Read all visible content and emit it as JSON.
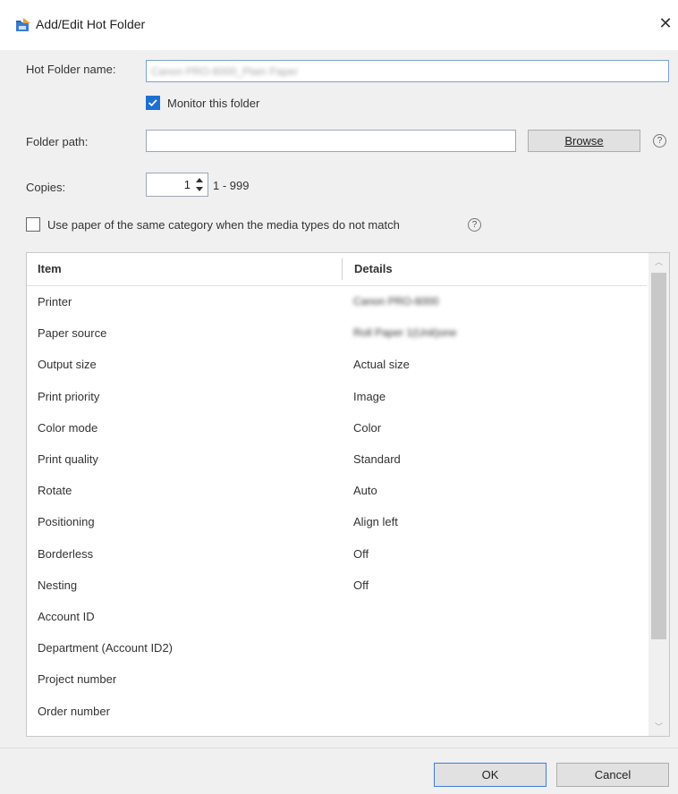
{
  "window": {
    "title": "Add/Edit Hot Folder",
    "close_glyph": "✕"
  },
  "form": {
    "hot_folder_name_label": "Hot Folder name:",
    "hot_folder_name_value": "Canon PRO-6000_Plain Paper",
    "monitor_label": "Monitor this folder",
    "monitor_checked": true,
    "folder_path_label": "Folder path:",
    "folder_path_value": "",
    "browse_label": "Browse",
    "copies_label": "Copies:",
    "copies_value": "1",
    "copies_range": "1 - 999",
    "same_category_label": "Use paper of the same category when the media types do not match",
    "same_category_checked": false,
    "help_glyph": "?"
  },
  "table": {
    "columns": [
      "Item",
      "Details"
    ],
    "rows": [
      {
        "item": "Printer",
        "details": "Canon PRO-6000",
        "blurred": true
      },
      {
        "item": "Paper source",
        "details": "Roll Paper 1(Unit)one",
        "blurred": true
      },
      {
        "item": "Output size",
        "details": "Actual size",
        "blurred": false
      },
      {
        "item": "Print priority",
        "details": "Image",
        "blurred": false
      },
      {
        "item": "Color mode",
        "details": "Color",
        "blurred": false
      },
      {
        "item": "Print quality",
        "details": "Standard",
        "blurred": false
      },
      {
        "item": "Rotate",
        "details": "Auto",
        "blurred": false
      },
      {
        "item": "Positioning",
        "details": "Align left",
        "blurred": false
      },
      {
        "item": "Borderless",
        "details": "Off",
        "blurred": false
      },
      {
        "item": "Nesting",
        "details": "Off",
        "blurred": false
      },
      {
        "item": "Account ID",
        "details": "",
        "blurred": false
      },
      {
        "item": "Department (Account ID2)",
        "details": "",
        "blurred": false
      },
      {
        "item": "Project number",
        "details": "",
        "blurred": false
      },
      {
        "item": "Order number",
        "details": "",
        "blurred": false
      }
    ]
  },
  "buttons": {
    "ok": "OK",
    "cancel": "Cancel"
  },
  "colors": {
    "accent": "#1f6fd1",
    "window_bg": "#f0f0f0"
  },
  "icons": {
    "title": "hot-folder-icon",
    "close": "close-icon",
    "help": "help-icon",
    "spin": "spin-arrows-icon"
  }
}
